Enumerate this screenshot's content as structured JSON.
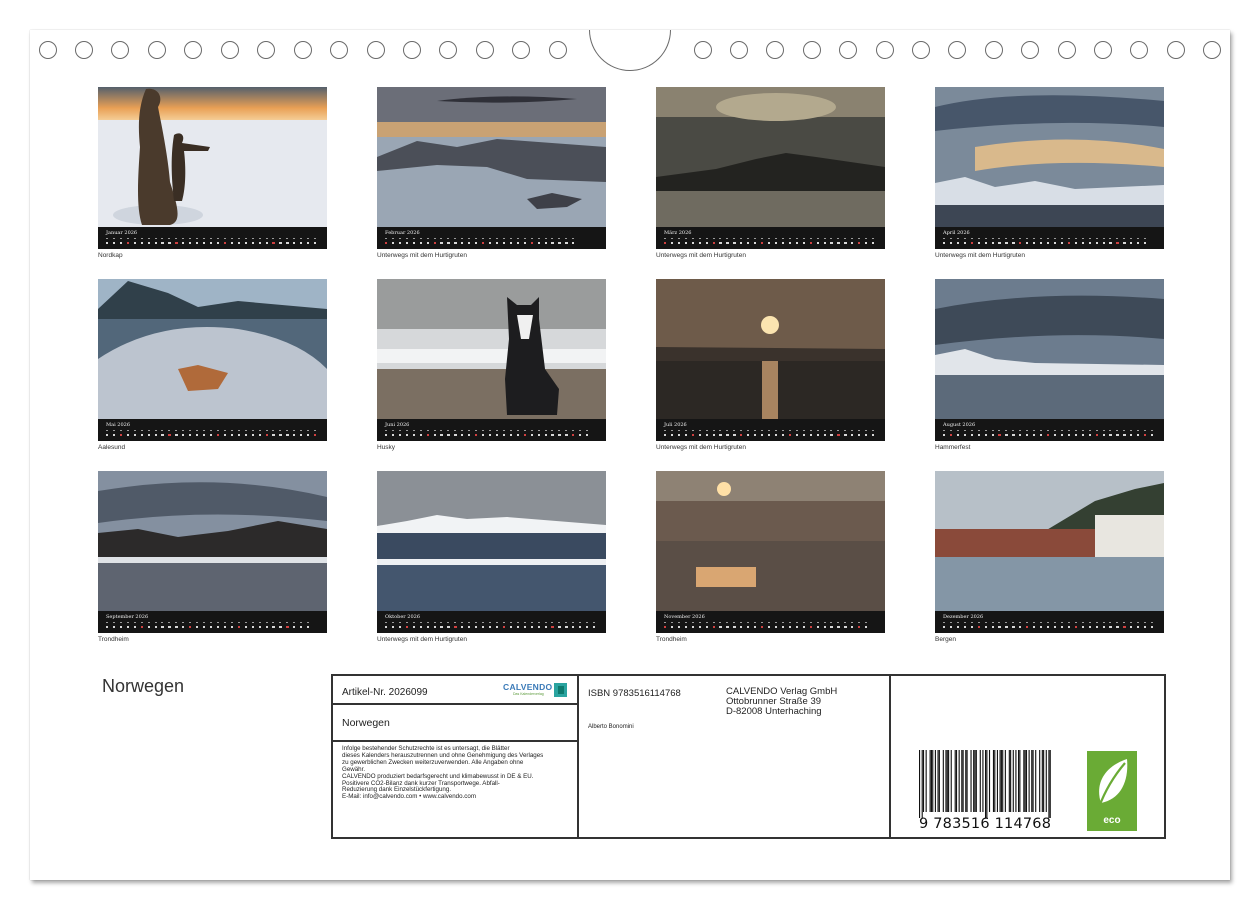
{
  "calendar": {
    "title": "Norwegen"
  },
  "months": [
    {
      "month": "Januar",
      "year": "2026",
      "caption": "Nordkap",
      "days": 31,
      "sundays": [
        4,
        11,
        18,
        25
      ]
    },
    {
      "month": "Februar",
      "year": "2026",
      "caption": "Unterwegs mit dem Hurtigruten",
      "days": 28,
      "sundays": [
        1,
        8,
        15,
        22
      ]
    },
    {
      "month": "März",
      "year": "2026",
      "caption": "Unterwegs mit dem Hurtigruten",
      "days": 31,
      "sundays": [
        1,
        8,
        15,
        22,
        29
      ]
    },
    {
      "month": "April",
      "year": "2026",
      "caption": "Unterwegs mit dem Hurtigruten",
      "days": 30,
      "sundays": [
        5,
        12,
        19,
        26
      ]
    },
    {
      "month": "Mai",
      "year": "2026",
      "caption": "Aalesund",
      "days": 31,
      "sundays": [
        3,
        10,
        17,
        24,
        31
      ]
    },
    {
      "month": "Juni",
      "year": "2026",
      "caption": "Husky",
      "days": 30,
      "sundays": [
        7,
        14,
        21,
        28
      ]
    },
    {
      "month": "Juli",
      "year": "2026",
      "caption": "Unterwegs mit dem Hurtigruten",
      "days": 31,
      "sundays": [
        5,
        12,
        19,
        26
      ]
    },
    {
      "month": "August",
      "year": "2026",
      "caption": "Hammerfest",
      "days": 31,
      "sundays": [
        2,
        9,
        16,
        23,
        30
      ]
    },
    {
      "month": "September",
      "year": "2026",
      "caption": "Trondheim",
      "days": 30,
      "sundays": [
        6,
        13,
        20,
        27
      ]
    },
    {
      "month": "Oktober",
      "year": "2026",
      "caption": "Unterwegs mit dem Hurtigruten",
      "days": 31,
      "sundays": [
        4,
        11,
        18,
        25
      ]
    },
    {
      "month": "November",
      "year": "2026",
      "caption": "Trondheim",
      "days": 30,
      "sundays": [
        1,
        8,
        15,
        22,
        29
      ]
    },
    {
      "month": "Dezember",
      "year": "2026",
      "caption": "Bergen",
      "days": 31,
      "sundays": [
        6,
        13,
        20,
        27
      ]
    }
  ],
  "imprint": {
    "article": "Artikel-Nr. 2026099",
    "logo_text": "CALVENDO",
    "logo_sub": "Das Kalenderverlag",
    "title": "Norwegen",
    "legal_lines": [
      "Infolge bestehender Schutzrechte ist es untersagt, die Blätter",
      "dieses Kalenders herauszutrennen und ohne Genehmigung des Verlages",
      "zu gewerblichen Zwecken weiterzuverwenden. Alle Angaben ohne",
      "Gewähr.",
      "CALVENDO produziert bedarfsgerecht und klimabewusst in DE & EU.",
      "Positivere CO2-Bilanz dank kurzer Transportwege. Abfall-",
      "Reduzierung dank Einzelstückfertigung.",
      "E-Mail: info@calvendo.com • www.calvendo.com"
    ],
    "isbn": "ISBN 9783516114768",
    "publisher_lines": [
      "CALVENDO Verlag GmbH",
      "Ottobrunner Straße 39",
      "D-82008 Unterhaching"
    ],
    "author": "Alberto Bonomini",
    "barcode_digits": "9   783516   114768",
    "eco_label": "eco"
  },
  "colors": {
    "calendar_strip": "#151515",
    "sunday_marker": "#d04040",
    "eco_green": "#6aab35",
    "logo_blue": "#3a7ab8"
  },
  "icons": {
    "binding": "spiral-ring-icon",
    "hanger": "hanger-notch-icon",
    "eco": "eco-leaf-icon",
    "logo": "calvendo-logo-icon"
  }
}
